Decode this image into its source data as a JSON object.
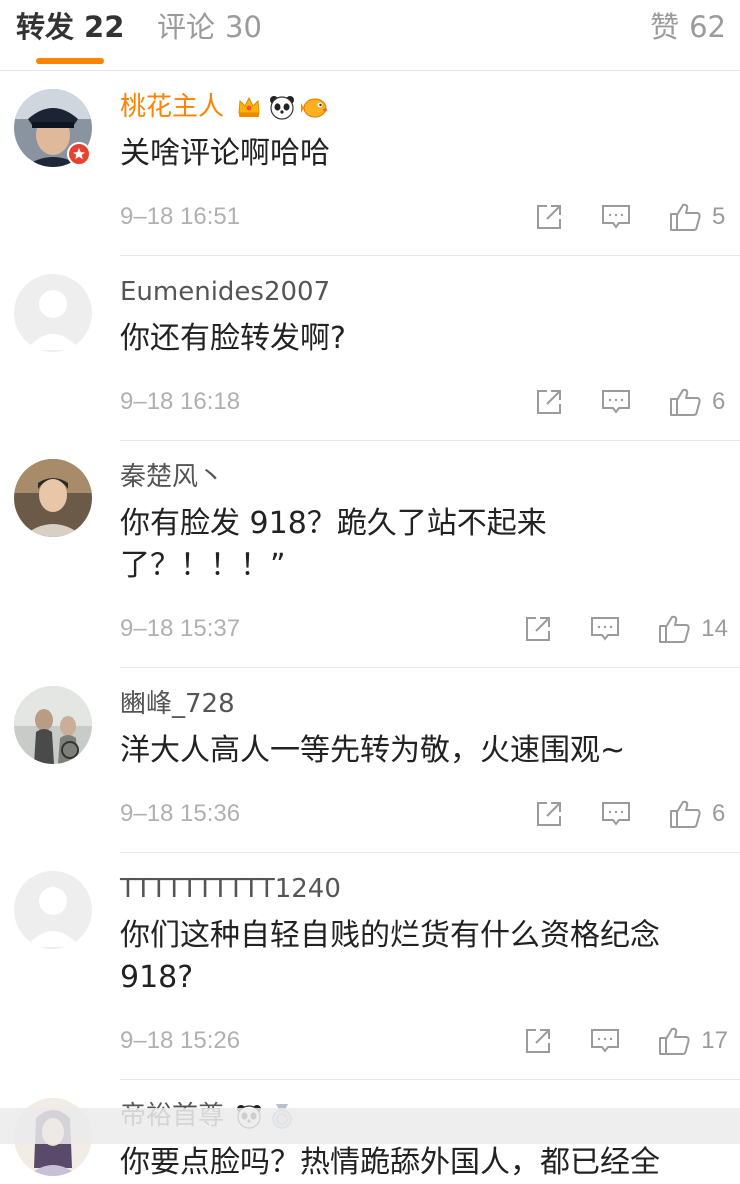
{
  "tabs": {
    "reposts": {
      "label": "转发",
      "count": "22"
    },
    "comments": {
      "label": "评论",
      "count": "30"
    },
    "likes": {
      "label": "赞",
      "count": "62"
    }
  },
  "comments": [
    {
      "username": "桃花主人",
      "username_color": "#ff8200",
      "badges": [
        "crown-icon",
        "panda-icon",
        "pufferfish-icon"
      ],
      "text": "关啥评论啊哈哈",
      "time": "9–18 16:51",
      "likes": "5"
    },
    {
      "username": "Eumenides2007",
      "text": "你还有脸转发啊?",
      "time": "9–18 16:18",
      "likes": "6"
    },
    {
      "username": "秦楚风丶",
      "text": "你有脸发 918？跪久了站不起来了？！！！”",
      "time": "9–18 15:37",
      "likes": "14"
    },
    {
      "username": "豳峰_728",
      "text": "洋大人高人一等先转为敬，火速围观~",
      "time": "9–18 15:36",
      "likes": "6"
    },
    {
      "username": "TTTTTTTTTT1240",
      "text": "你们这种自轻自贱的烂货有什么资格纪念918?",
      "time": "9–18 15:26",
      "likes": "17"
    },
    {
      "username": "帝裕首尊",
      "badges": [
        "panda-icon",
        "medal-icon"
      ],
      "text": "你要点脸吗？热情跪舔外国人，都已经全"
    }
  ],
  "colors": {
    "accent": "#ff8200",
    "divider": "#e8e8e8",
    "muted_text": "#b0b0b0"
  }
}
